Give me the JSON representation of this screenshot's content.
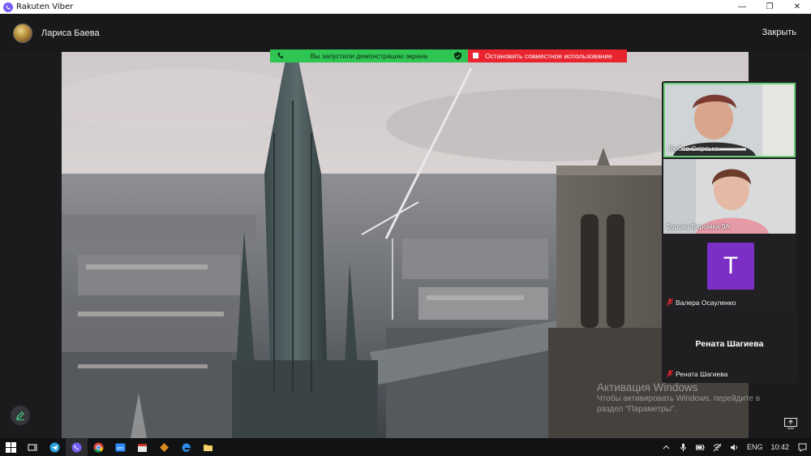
{
  "window": {
    "app_title": "Rakuten Viber",
    "controls": {
      "minimize": "—",
      "maximize": "❐",
      "close": "✕"
    }
  },
  "call": {
    "caller_name": "Лариса Баева",
    "close_label": "Закрыть"
  },
  "screen_share": {
    "status_text": "Вы запустили демонстрацию экрана",
    "stop_label": "Остановить совместное использование",
    "colors": {
      "status": "#2fc553",
      "stop": "#e8252f"
    }
  },
  "participants": [
    {
      "name": "Любов Скірська",
      "muted": false,
      "active_speaker": true
    },
    {
      "name": "Бурова Вєроніка 9А",
      "muted": false
    },
    {
      "name": "Валера Осауленко",
      "muted": true,
      "avatar_letter": "T",
      "avatar_color": "#7b2fc4"
    },
    {
      "name": "Рената Шагиева",
      "muted": true,
      "center_name": "Рената Шагиева"
    }
  ],
  "watermark": {
    "title": "Активация Windows",
    "line1": "Чтобы активировать Windows, перейдите в",
    "line2": "раздел \"Параметры\"."
  },
  "taskbar": {
    "icons": [
      "windows-start-icon",
      "task-view-icon",
      "telegram-icon",
      "viber-icon",
      "chrome-icon",
      "zoom-icon",
      "calendar-app-icon",
      "media-app-icon",
      "edge-icon",
      "file-explorer-icon"
    ],
    "language": "ENG",
    "time": "10:42"
  }
}
